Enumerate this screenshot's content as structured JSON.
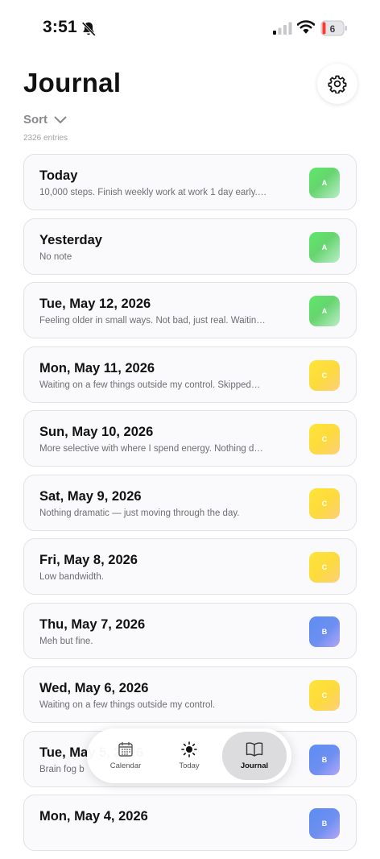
{
  "status_bar": {
    "time": "3:51",
    "battery_level": "6",
    "icons": [
      "bell-slash-icon",
      "cellular-signal-icon",
      "wifi-icon",
      "battery-icon"
    ]
  },
  "header": {
    "title": "Journal",
    "settings_icon": "gear-icon",
    "sort_label": "Sort",
    "sort_icon": "chevron-down-icon",
    "entry_count": "2326 entries"
  },
  "entries": [
    {
      "date": "Today",
      "note": "10,000 steps. Finish weekly work at work 1 day early.…",
      "grade": "A"
    },
    {
      "date": "Yesterday",
      "note": "No note",
      "grade": "A"
    },
    {
      "date": "Tue, May 12, 2026",
      "note": "Feeling older in small ways. Not bad, just real. Waitin…",
      "grade": "A"
    },
    {
      "date": "Mon, May 11, 2026",
      "note": "Waiting on a few things outside my control. Skipped…",
      "grade": "C"
    },
    {
      "date": "Sun, May 10, 2026",
      "note": "More selective with where I spend energy. Nothing d…",
      "grade": "C"
    },
    {
      "date": "Sat, May 9, 2026",
      "note": "Nothing dramatic — just moving through the day.",
      "grade": "C"
    },
    {
      "date": "Fri, May 8, 2026",
      "note": "Low bandwidth.",
      "grade": "C"
    },
    {
      "date": "Thu, May 7, 2026",
      "note": "Meh but fine.",
      "grade": "B"
    },
    {
      "date": "Wed, May 6, 2026",
      "note": "Waiting on a few things outside my control.",
      "grade": "C"
    },
    {
      "date": "Tue, May 5, 2026",
      "note": "Brain fog b",
      "grade": "B"
    },
    {
      "date": "Mon, May 4, 2026",
      "note": "",
      "grade": "B"
    }
  ],
  "grade_colors": {
    "A": "#5fe86a",
    "B": "#5c8ef2",
    "C": "#ffe43a"
  },
  "tab_bar": {
    "tabs": [
      {
        "label": "Calendar",
        "icon": "calendar-icon",
        "selected": false
      },
      {
        "label": "Today",
        "icon": "sun-icon",
        "selected": false
      },
      {
        "label": "Journal",
        "icon": "book-icon",
        "selected": true
      }
    ]
  }
}
